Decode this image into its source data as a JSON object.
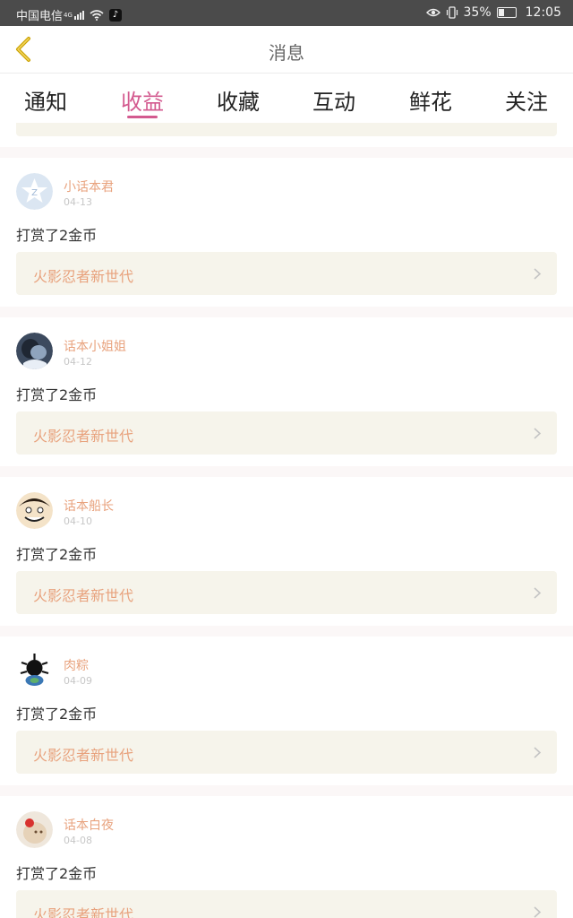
{
  "status": {
    "carrier": "中国电信",
    "network": "4G",
    "battery": "35%",
    "battery_level": 0.35,
    "time": "12:05",
    "icons": [
      "signal-icon",
      "wifi-icon",
      "app-icon",
      "eye-icon",
      "vibrate-icon",
      "battery-icon"
    ]
  },
  "header": {
    "title": "消息",
    "back_icon": "chevron-left-icon"
  },
  "tabs": [
    {
      "label": "通知",
      "active": false
    },
    {
      "label": "收益",
      "active": true
    },
    {
      "label": "收藏",
      "active": false
    },
    {
      "label": "互动",
      "active": false
    },
    {
      "label": "鲜花",
      "active": false
    },
    {
      "label": "关注",
      "active": false
    }
  ],
  "colors": {
    "accent": "#d35a8f",
    "username": "#e8a27d",
    "link_bg": "#f6f4eb",
    "status_bar": "#4b4b4b"
  },
  "messages": [
    {
      "user": "小话本君",
      "date": "04-13",
      "text": "打赏了2金币",
      "work": "火影忍者新世代"
    },
    {
      "user": "话本小姐姐",
      "date": "04-12",
      "text": "打赏了2金币",
      "work": "火影忍者新世代"
    },
    {
      "user": "话本船长",
      "date": "04-10",
      "text": "打赏了2金币",
      "work": "火影忍者新世代"
    },
    {
      "user": "肉粽",
      "date": "04-09",
      "text": "打赏了2金币",
      "work": "火影忍者新世代"
    },
    {
      "user": "话本白夜",
      "date": "04-08",
      "text": "打赏了2金币",
      "work": "火影忍者新世代"
    }
  ]
}
